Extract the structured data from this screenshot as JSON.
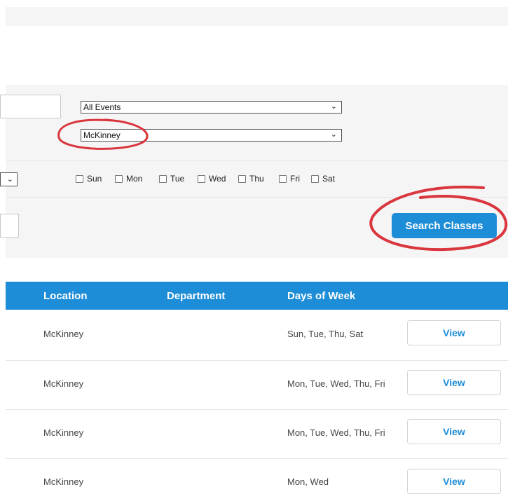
{
  "filters": {
    "event_type": "All Events",
    "location": "McKinney",
    "days": [
      "Sun",
      "Mon",
      "Tue",
      "Wed",
      "Thu",
      "Fri",
      "Sat"
    ],
    "search_button": "Search Classes"
  },
  "table": {
    "columns": [
      "Location",
      "Department",
      "Days of Week"
    ],
    "rows": [
      {
        "location": "McKinney",
        "department": "",
        "days": "Sun, Tue, Thu, Sat",
        "action": "View"
      },
      {
        "location": "McKinney",
        "department": "",
        "days": "Mon, Tue, Wed, Thu, Fri",
        "action": "View"
      },
      {
        "location": "McKinney",
        "department": "",
        "days": "Mon, Tue, Wed, Thu, Fri",
        "action": "View"
      },
      {
        "location": "McKinney",
        "department": "",
        "days": "Mon, Wed",
        "action": "View"
      }
    ]
  },
  "colors": {
    "accent": "#1e8dd8",
    "annotation": "#d9363e",
    "panel": "#f5f5f6"
  }
}
